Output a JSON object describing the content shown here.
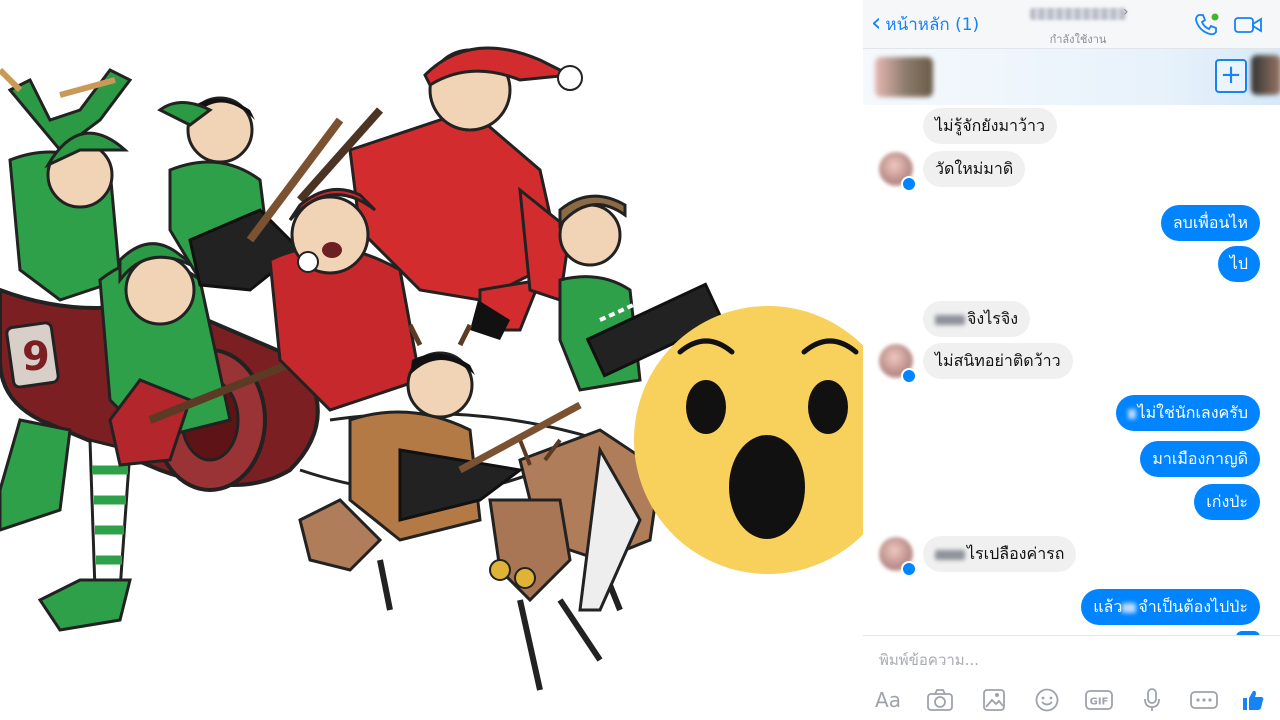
{
  "messenger": {
    "header": {
      "back_label": "หน้าหลัก (1)",
      "contact_name": "",
      "status": "กำลังใช้งาน"
    },
    "messages": [
      {
        "side": "received",
        "text": "ไม่รู้จักยังมาว้าว"
      },
      {
        "side": "received",
        "text": "วัดใหม่มาดิ"
      },
      {
        "side": "sent",
        "text": "ลบเพื่อนไห"
      },
      {
        "side": "sent",
        "text": "ไป"
      },
      {
        "side": "received",
        "text": "จิงไรจิง"
      },
      {
        "side": "received",
        "text": "ไม่สนิทอย่าติดว้าว"
      },
      {
        "side": "sent",
        "text": "ไม่ใช่นักเลงครับ"
      },
      {
        "side": "sent",
        "text": "มาเมืองกาญดิ"
      },
      {
        "side": "sent",
        "text": "เก่งป่ะ"
      },
      {
        "side": "received",
        "text": "ไรเปลืองค่ารถ"
      },
      {
        "side": "sent",
        "text_before": "แล้ว",
        "text_after": "จำเป็นต้องไปป่ะ"
      }
    ],
    "composer": {
      "placeholder": "พิมพ์ข้อความ...",
      "aa_label": "Aa"
    },
    "colors": {
      "accent": "#0084ff",
      "header_blue": "#1683f6",
      "received_bubble": "#f0f0f0",
      "online_dot": "#42b72a"
    },
    "icons": [
      "phone-icon",
      "video-camera-icon",
      "add-people-icon",
      "camera-icon",
      "gallery-icon",
      "emoji-icon",
      "gif-icon",
      "microphone-icon",
      "more-icon",
      "thumbs-up-icon"
    ]
  },
  "illustration": {
    "sleigh_number": "9",
    "reaction": "wow-emoji"
  }
}
